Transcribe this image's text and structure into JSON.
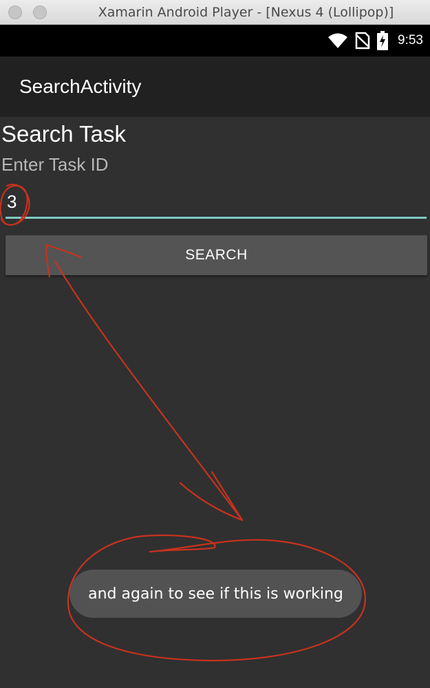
{
  "window": {
    "title": "Xamarin Android Player - [Nexus 4 (Lollipop)]"
  },
  "status_bar": {
    "time": "9:53",
    "icons": [
      "wifi-icon",
      "no-sim-icon",
      "battery-charging-icon"
    ]
  },
  "action_bar": {
    "title": "SearchActivity"
  },
  "form": {
    "heading": "Search Task",
    "label": "Enter Task ID",
    "task_id_value": "3",
    "search_button_label": "SEARCH"
  },
  "toast": {
    "message": "and again to see if this is working"
  },
  "colors": {
    "background": "#303030",
    "action_bar": "#212121",
    "input_underline": "#7fcbc4",
    "button": "#545454",
    "annotation": "#c8321e"
  }
}
